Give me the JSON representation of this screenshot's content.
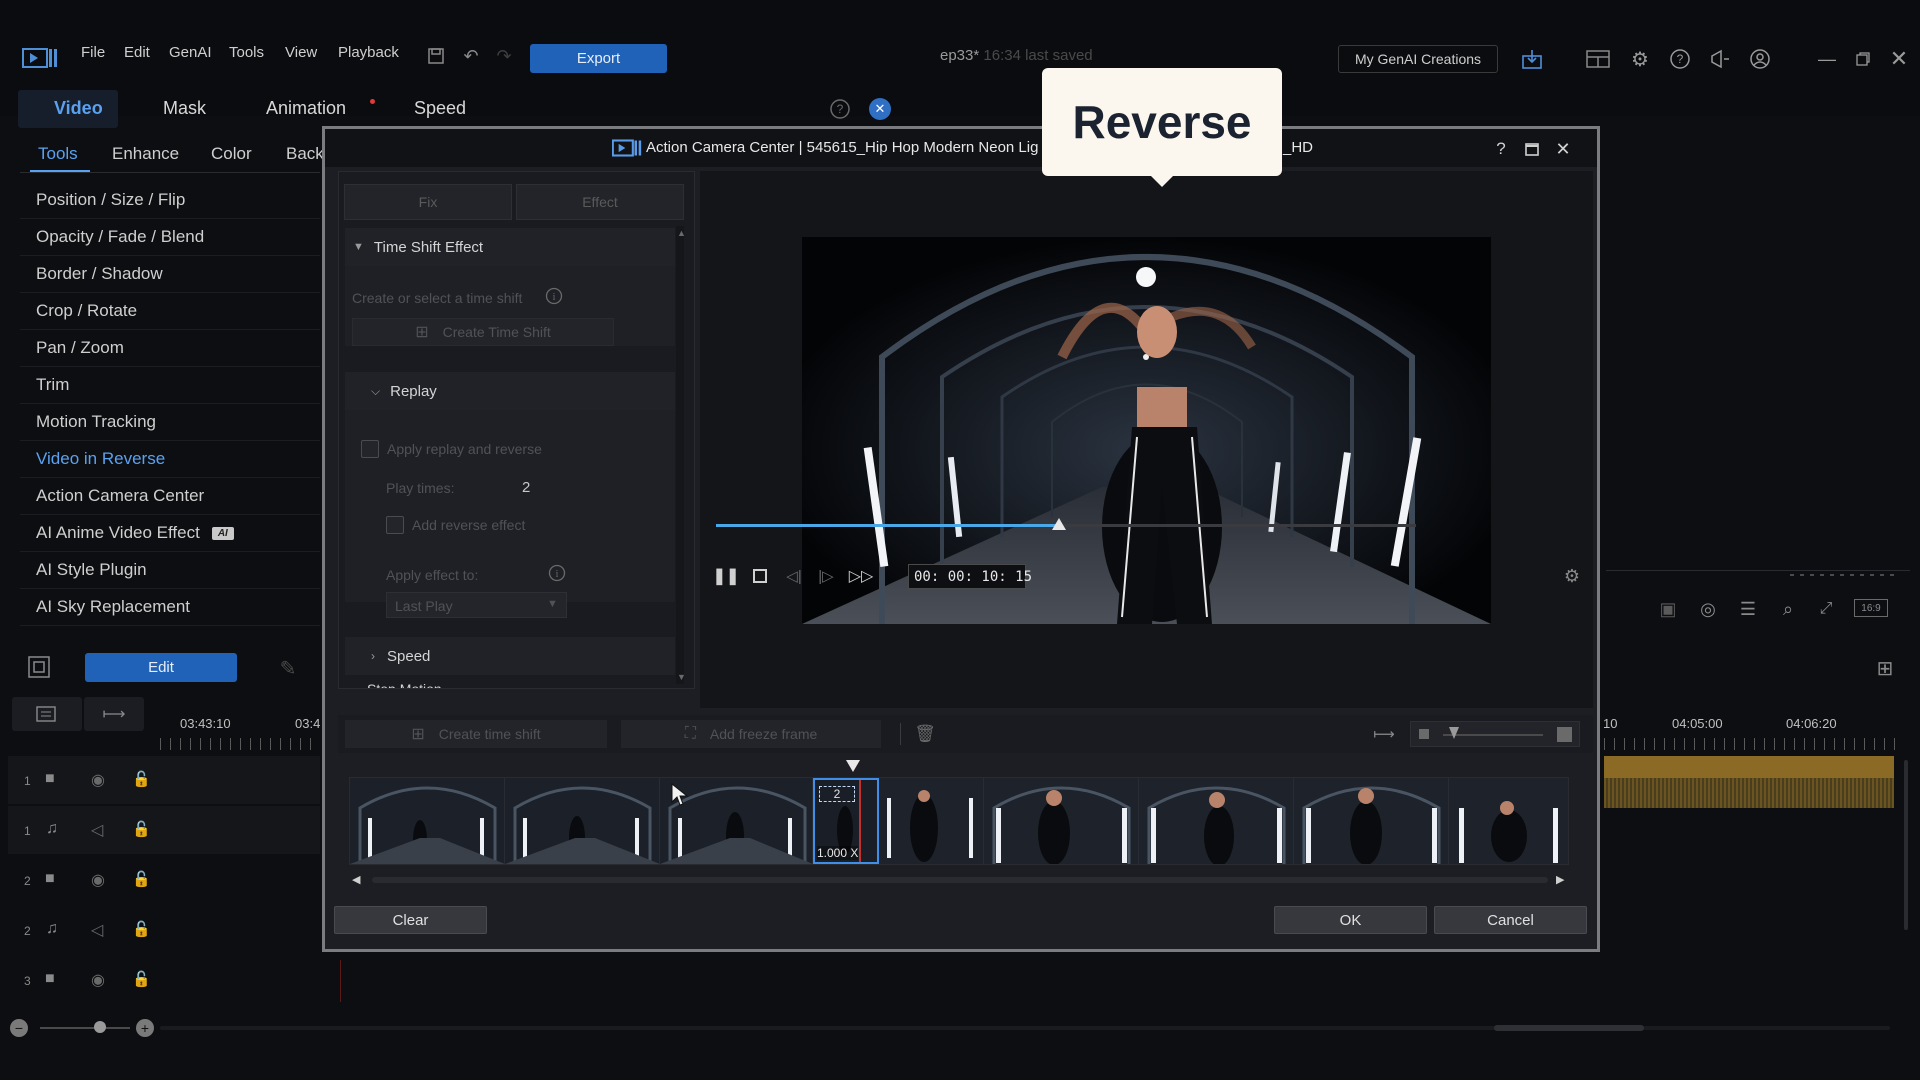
{
  "menu": {
    "file": "File",
    "edit": "Edit",
    "genai": "GenAI",
    "tools": "Tools",
    "view": "View",
    "playback": "Playback"
  },
  "export_label": "Export",
  "project": {
    "name": "ep33*",
    "saved": "16:34 last saved"
  },
  "my_genai": "My GenAI Creations",
  "tabs": {
    "video": "Video",
    "mask": "Mask",
    "animation": "Animation",
    "speed": "Speed"
  },
  "subtabs": {
    "tools": "Tools",
    "enhance": "Enhance",
    "color": "Color",
    "back": "Back"
  },
  "tools": {
    "pos": "Position / Size / Flip",
    "opacity": "Opacity / Fade / Blend",
    "border": "Border / Shadow",
    "crop": "Crop / Rotate",
    "pan": "Pan / Zoom",
    "trim": "Trim",
    "motion": "Motion Tracking",
    "reverse": "Video in Reverse",
    "acc": "Action Camera Center",
    "anime": "AI Anime Video Effect",
    "ai_badge": "AI",
    "style": "AI Style Plugin",
    "sky": "AI Sky Replacement"
  },
  "edit_label": "Edit",
  "timeline": {
    "t1": "03:43:10",
    "t2": "03:4",
    "t3": "10",
    "t4": "04:05:00",
    "t5": "04:06:20"
  },
  "tracks": [
    "1",
    "1",
    "2",
    "2",
    "3"
  ],
  "dialog": {
    "title_left": "Action Camera Center  |  545615_Hip Hop Modern Neon Lig",
    "title_right": "_HD",
    "fix": "Fix",
    "effect": "Effect",
    "time_shift_effect": "Time Shift Effect",
    "create_or_select": "Create or select a time shift",
    "create_time_shift": "Create Time Shift",
    "replay": "Replay",
    "apply_replay": "Apply replay and reverse",
    "play_times_label": "Play times:",
    "play_times_value": "2",
    "add_reverse": "Add reverse effect",
    "apply_effect_to": "Apply effect to:",
    "apply_select": "Last Play",
    "speed": "Speed",
    "stop_motion": "Stop Motion",
    "timecode": "00: 00: 10: 15",
    "create_time_shift2": "Create time shift",
    "add_freeze": "Add freeze frame",
    "sel_count": "2",
    "sel_speed": "1.000 X",
    "clear": "Clear",
    "ok": "OK",
    "cancel": "Cancel"
  },
  "callout": "Reverse",
  "playback": {
    "progress": 0.49
  },
  "colors": {
    "accent": "#1f62b8",
    "highlight": "#5aa2f0"
  }
}
